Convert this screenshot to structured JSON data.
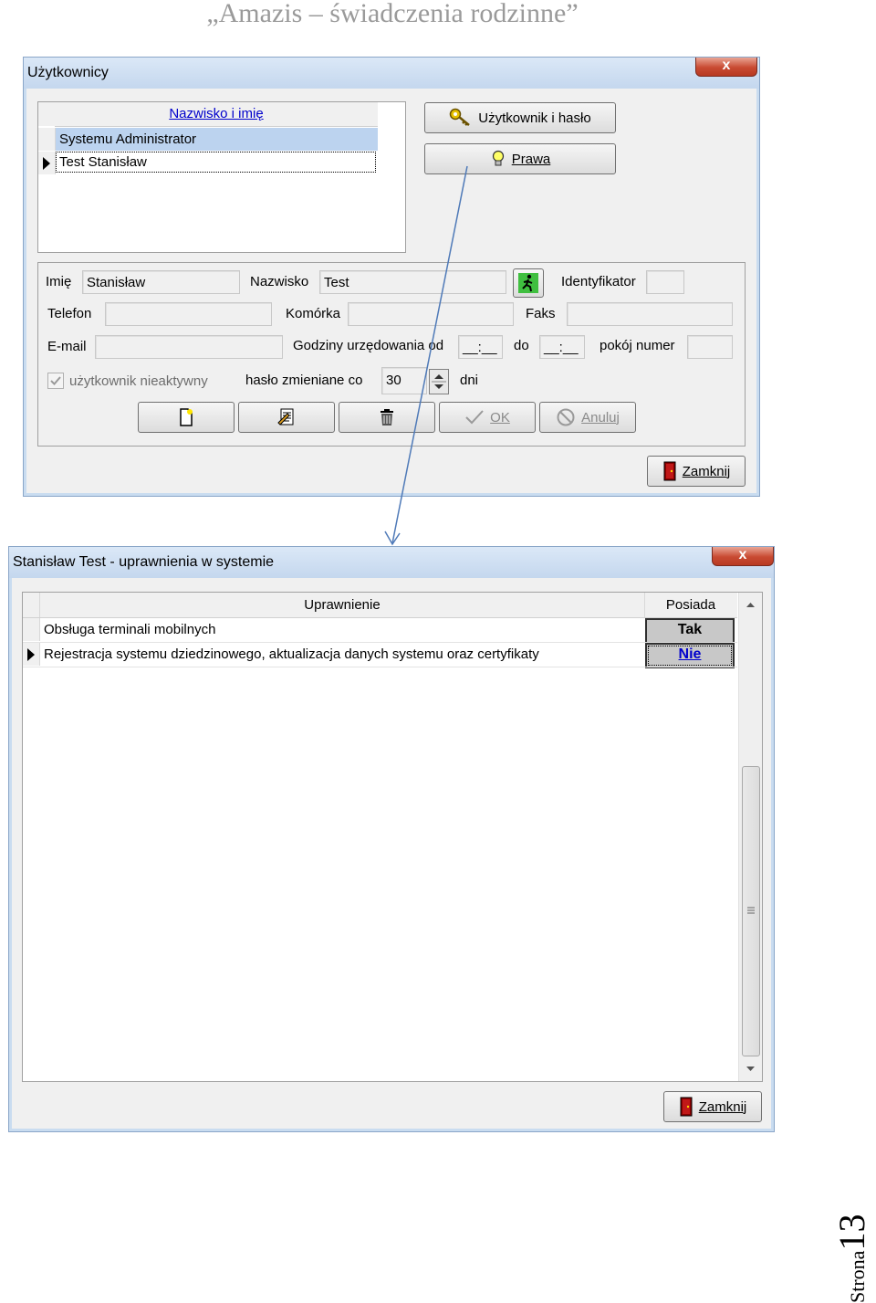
{
  "doc_header": "„Amazis – świadczenia rodzinne”",
  "footer": {
    "label": "Strona",
    "number": "13"
  },
  "users_window": {
    "title": "Użytkownicy",
    "close_label": "x",
    "list": {
      "column_header": "Nazwisko i imię",
      "rows": [
        "Systemu Administrator",
        "Test Stanisław"
      ]
    },
    "buttons": {
      "user_password": "Użytkownik i hasło",
      "rights": "Prawa"
    },
    "form": {
      "first_name_label": "Imię",
      "first_name_value": "Stanisław",
      "last_name_label": "Nazwisko",
      "last_name_value": "Test",
      "identifier_label": "Identyfikator",
      "identifier_value": "",
      "phone_label": "Telefon",
      "phone_value": "",
      "mobile_label": "Komórka",
      "mobile_value": "",
      "fax_label": "Faks",
      "fax_value": "",
      "email_label": "E-mail",
      "email_value": "",
      "hours_from_label": "Godziny urzędowania od",
      "hours_from_value": "__:__",
      "hours_to_label": "do",
      "hours_to_value": "__:__",
      "room_label": "pokój numer",
      "room_value": "",
      "inactive_label": "użytkownik nieaktywny",
      "password_change_label": "hasło zmieniane co",
      "password_change_value": "30",
      "days_label": "dni"
    },
    "actions": {
      "ok": "OK",
      "cancel": "Anuluj"
    },
    "close_button": "Zamknij"
  },
  "rights_window": {
    "title": "Stanisław Test - uprawnienia w systemie",
    "close_label": "x",
    "columns": {
      "permission": "Uprawnienie",
      "has": "Posiada"
    },
    "rows": [
      {
        "permission": "Obsługa terminali mobilnych",
        "has": "Tak"
      },
      {
        "permission": "Rejestracja systemu dziedzinowego, aktualizacja danych systemu oraz certyfikaty",
        "has": "Nie"
      }
    ],
    "close_button": "Zamknij"
  },
  "colors": {
    "link_blue": "#0000cc",
    "selection": "#bcd3ef",
    "arrow": "#4f7ab8"
  }
}
